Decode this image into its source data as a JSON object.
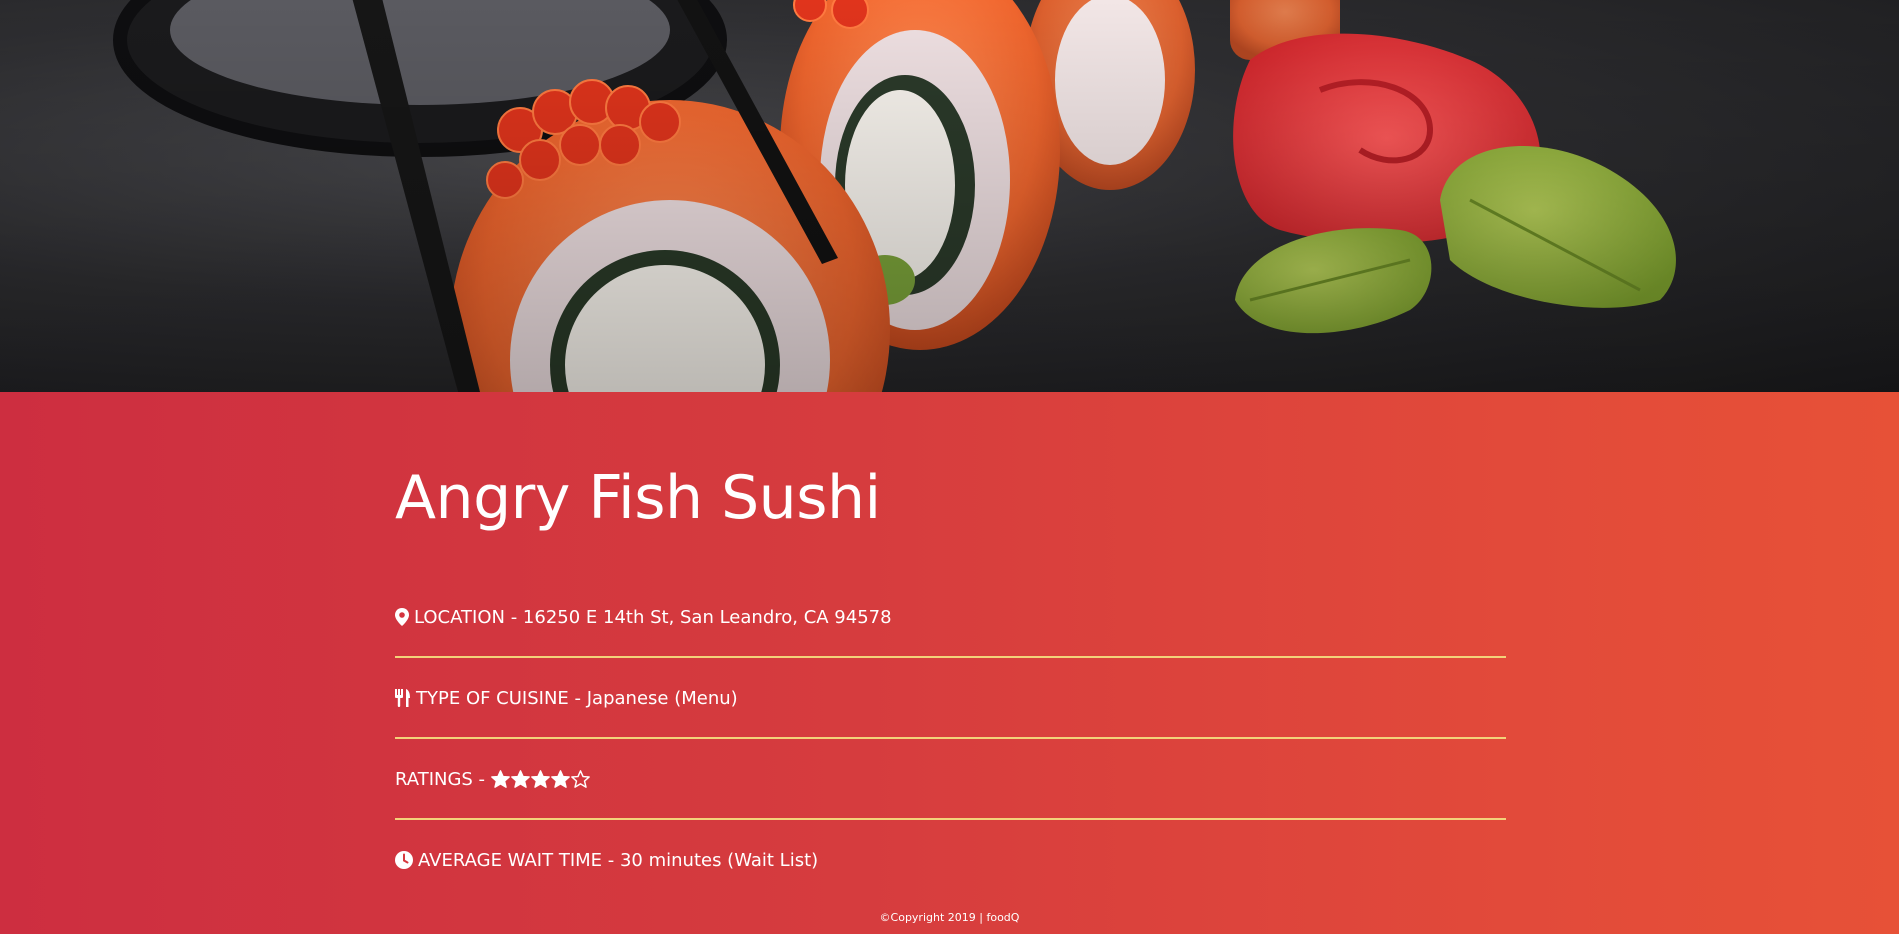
{
  "restaurant": {
    "name": "Angry Fish Sushi"
  },
  "details": {
    "location": {
      "label": "LOCATION - 16250 E 14th St, San Leandro, CA 94578",
      "icon": "map-marker-icon"
    },
    "cuisine": {
      "label": "TYPE OF CUISINE - Japanese ( ",
      "link_text": "Menu",
      "suffix": " )",
      "icon": "utensils-icon"
    },
    "ratings": {
      "label": "RATINGS - ",
      "value": 4,
      "max": 5,
      "icon_filled": "star-icon",
      "icon_empty": "star-outline-icon"
    },
    "wait_time": {
      "label": "AVERAGE WAIT TIME - 30 minutes ( ",
      "link_text": "Wait List",
      "suffix": " )",
      "icon": "clock-icon"
    }
  },
  "footer": {
    "text": "©Copyright 2019 | foodQ"
  },
  "colors": {
    "panel_gradient_start": "#cd2e40",
    "panel_gradient_end": "#e75137",
    "divider": "#f3d27a",
    "text": "#ffffff"
  }
}
